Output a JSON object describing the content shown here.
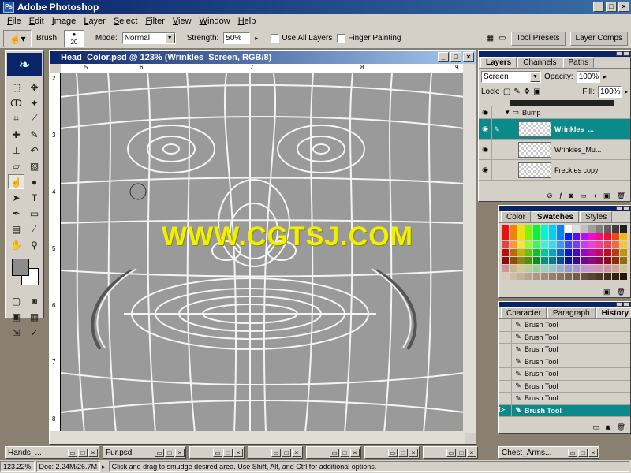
{
  "app": {
    "title": "Adobe Photoshop"
  },
  "menu": [
    "File",
    "Edit",
    "Image",
    "Layer",
    "Select",
    "Filter",
    "View",
    "Window",
    "Help"
  ],
  "options": {
    "brush_label": "Brush:",
    "brush_size": "20",
    "mode_label": "Mode:",
    "mode_value": "Normal",
    "strength_label": "Strength:",
    "strength_value": "50%",
    "use_all_layers": "Use All Layers",
    "finger_painting": "Finger Painting",
    "tool_presets": "Tool Presets",
    "layer_comps": "Layer Comps"
  },
  "document": {
    "title": "Head_Color.psd @ 123% (Wrinkles_Screen, RGB/8)",
    "ruler_top": [
      "5",
      "6",
      "7",
      "8",
      "9"
    ],
    "ruler_left": [
      "2",
      "3",
      "4",
      "5",
      "6",
      "7",
      "8"
    ],
    "watermark": "WWW.CGTSJ.COM"
  },
  "layers_panel": {
    "tabs": [
      "Layers",
      "Channels",
      "Paths"
    ],
    "blend_mode": "Screen",
    "opacity_label": "Opacity:",
    "opacity_value": "100%",
    "lock_label": "Lock:",
    "fill_label": "Fill:",
    "fill_value": "100%",
    "group_name": "Bump",
    "layers": [
      {
        "name": "Wrinkles_...",
        "selected": true
      },
      {
        "name": "Wrinkles_Mu...",
        "selected": false
      },
      {
        "name": "Freckles copy",
        "selected": false
      }
    ]
  },
  "swatches_panel": {
    "tabs": [
      "Color",
      "Swatches",
      "Styles"
    ]
  },
  "history_panel": {
    "tabs": [
      "Character",
      "Paragraph",
      "History"
    ],
    "items": [
      "Brush Tool",
      "Brush Tool",
      "Brush Tool",
      "Brush Tool",
      "Brush Tool",
      "Brush Tool",
      "Brush Tool",
      "Brush Tool"
    ],
    "selected_index": 7
  },
  "minimized_docs": [
    "Hands_...",
    "Fur.psd",
    "Chest_Arms..."
  ],
  "status": {
    "zoom": "123.22%",
    "doc": "Doc: 2.24M/26.7M",
    "hint": "Click and drag to smudge desired area.  Use Shift, Alt, and Ctrl for additional options."
  }
}
